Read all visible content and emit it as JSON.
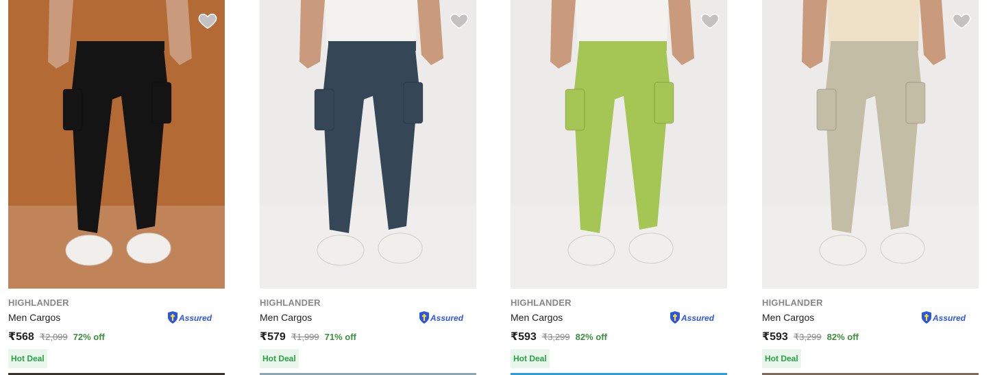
{
  "products": [
    {
      "brand": "HIGHLANDER",
      "title": "Men Cargos",
      "price": "₹568",
      "mrp": "₹2,099",
      "discount": "72% off",
      "badge": "Hot Deal",
      "assured_label": "Assured",
      "wishlist_icon": "heart-icon",
      "image_bg": "#b46a34",
      "pant_color": "#141414",
      "shirt_color": "#b46a34",
      "peek_color": "#3a342e"
    },
    {
      "brand": "HIGHLANDER",
      "title": "Men Cargos",
      "price": "₹579",
      "mrp": "₹1,999",
      "discount": "71% off",
      "badge": "Hot Deal",
      "assured_label": "Assured",
      "wishlist_icon": "heart-icon",
      "image_bg": "#ecebea",
      "pant_color": "#354657",
      "shirt_color": "#f4f2ee",
      "peek_color": "#8fa6b0"
    },
    {
      "brand": "HIGHLANDER",
      "title": "Men Cargos",
      "price": "₹593",
      "mrp": "₹3,299",
      "discount": "82% off",
      "badge": "Hot Deal",
      "assured_label": "Assured",
      "wishlist_icon": "heart-icon",
      "image_bg": "#ecebea",
      "pant_color": "#a5c554",
      "shirt_color": "#f4f2ee",
      "peek_color": "#2d9fd6"
    },
    {
      "brand": "HIGHLANDER",
      "title": "Men Cargos",
      "price": "₹593",
      "mrp": "₹3,299",
      "discount": "82% off",
      "badge": "Hot Deal",
      "assured_label": "Assured",
      "wishlist_icon": "heart-icon",
      "image_bg": "#ecebea",
      "pant_color": "#c3bda5",
      "shirt_color": "#efe1c8",
      "peek_color": "#7a6b5c"
    }
  ],
  "colors": {
    "price_text": "#212121",
    "brand_text": "#878787",
    "discount_green": "#388e3c",
    "deal_green": "#26a541",
    "deal_bg": "#e9f6ec",
    "assured_blue": "#2a55e5"
  }
}
